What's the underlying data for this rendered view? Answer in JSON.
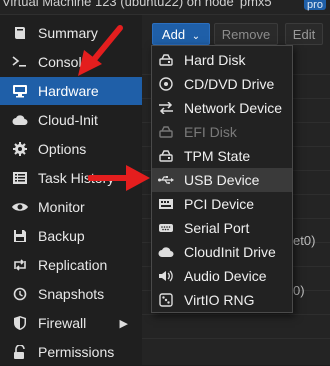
{
  "window": {
    "title": "Virtual Machine 123 (ubuntu22) on node 'pmx5'",
    "node_badge": "pro"
  },
  "sidebar": {
    "items": [
      {
        "label": "Summary",
        "icon": "book-icon",
        "active": false
      },
      {
        "label": "Console",
        "icon": "terminal-icon",
        "active": false
      },
      {
        "label": "Hardware",
        "icon": "monitor-icon",
        "active": true
      },
      {
        "label": "Cloud-Init",
        "icon": "cloud-icon",
        "active": false
      },
      {
        "label": "Options",
        "icon": "gear-icon",
        "active": false
      },
      {
        "label": "Task History",
        "icon": "list-icon",
        "active": false
      },
      {
        "label": "Monitor",
        "icon": "eye-icon",
        "active": false
      },
      {
        "label": "Backup",
        "icon": "floppy-icon",
        "active": false
      },
      {
        "label": "Replication",
        "icon": "retweet-icon",
        "active": false
      },
      {
        "label": "Snapshots",
        "icon": "history-icon",
        "active": false
      },
      {
        "label": "Firewall",
        "icon": "shield-icon",
        "active": false,
        "has_submenu": true
      },
      {
        "label": "Permissions",
        "icon": "unlock-icon",
        "active": false
      }
    ]
  },
  "toolbar": {
    "add_label": "Add",
    "remove_label": "Remove",
    "edit_label": "Edit"
  },
  "background_rows": {
    "row_a": "et0)",
    "row_b": "0)"
  },
  "add_menu": {
    "items": [
      {
        "label": "Hard Disk",
        "icon": "hdd-icon",
        "enabled": true,
        "highlighted": false
      },
      {
        "label": "CD/DVD Drive",
        "icon": "disc-icon",
        "enabled": true,
        "highlighted": false
      },
      {
        "label": "Network Device",
        "icon": "exchange-icon",
        "enabled": true,
        "highlighted": false
      },
      {
        "label": "EFI Disk",
        "icon": "hdd-icon",
        "enabled": false,
        "highlighted": false
      },
      {
        "label": "TPM State",
        "icon": "hdd-icon",
        "enabled": true,
        "highlighted": false
      },
      {
        "label": "USB Device",
        "icon": "usb-icon",
        "enabled": true,
        "highlighted": true
      },
      {
        "label": "PCI Device",
        "icon": "pci-card-icon",
        "enabled": true,
        "highlighted": false
      },
      {
        "label": "Serial Port",
        "icon": "serial-port-icon",
        "enabled": true,
        "highlighted": false
      },
      {
        "label": "CloudInit Drive",
        "icon": "cloud-icon",
        "enabled": true,
        "highlighted": false
      },
      {
        "label": "Audio Device",
        "icon": "speaker-icon",
        "enabled": true,
        "highlighted": false
      },
      {
        "label": "VirtIO RNG",
        "icon": "dice-icon",
        "enabled": true,
        "highlighted": false
      }
    ]
  },
  "colors": {
    "accent": "#1f5fa8",
    "annotation_arrow": "#e41e1e"
  }
}
